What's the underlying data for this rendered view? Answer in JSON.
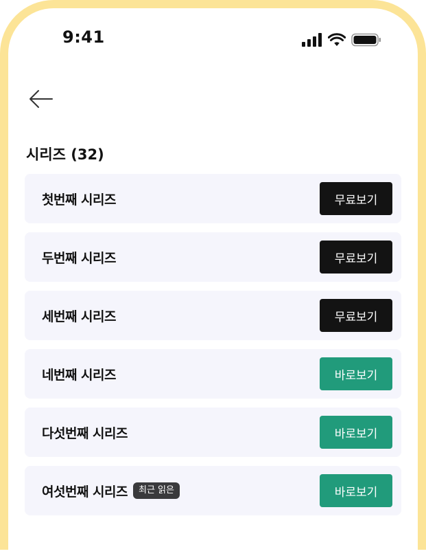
{
  "status_bar": {
    "time": "9:41",
    "icons": [
      "cellular-signal-icon",
      "wifi-icon",
      "battery-icon"
    ]
  },
  "nav": {
    "back_icon": "arrow-left-icon"
  },
  "section": {
    "title": "시리즈 (32)"
  },
  "colors": {
    "frame": "#FCE497",
    "card_bg": "#F5F5FC",
    "free_button": "#131313",
    "view_button": "#219B7B",
    "badge": "#3A3A3C"
  },
  "series": [
    {
      "name": "첫번째 시리즈",
      "button_label": "무료보기",
      "button_type": "free",
      "badge": ""
    },
    {
      "name": "두번째 시리즈",
      "button_label": "무료보기",
      "button_type": "free",
      "badge": ""
    },
    {
      "name": "세번째 시리즈",
      "button_label": "무료보기",
      "button_type": "free",
      "badge": ""
    },
    {
      "name": "네번째 시리즈",
      "button_label": "바로보기",
      "button_type": "view",
      "badge": ""
    },
    {
      "name": "다섯번째 시리즈",
      "button_label": "바로보기",
      "button_type": "view",
      "badge": ""
    },
    {
      "name": "여섯번째 시리즈",
      "button_label": "바로보기",
      "button_type": "view",
      "badge": "최근 읽은"
    }
  ]
}
